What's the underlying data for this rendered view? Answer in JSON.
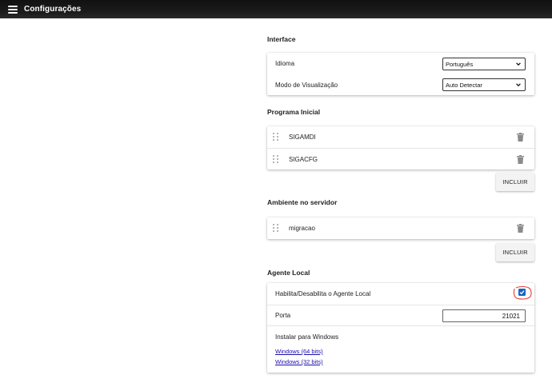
{
  "header": {
    "title": "Configurações",
    "menu_icon": "hamburger-menu-icon"
  },
  "interface": {
    "title": "Interface",
    "idioma_label": "Idioma",
    "idioma_value": "Português",
    "modo_label": "Modo de Visualização",
    "modo_value": "Auto Detectar"
  },
  "programa_inicial": {
    "title": "Programa Inicial",
    "items": [
      {
        "label": "SIGAMDI"
      },
      {
        "label": "SIGACFG"
      }
    ],
    "include_label": "INCLUIR"
  },
  "ambiente": {
    "title": "Ambiente no servidor",
    "items": [
      {
        "label": "migracao"
      }
    ],
    "include_label": "INCLUIR"
  },
  "agente_local": {
    "title": "Agente Local",
    "toggle_label": "Habilita/Desabilita o Agente Local",
    "toggle_checked": true,
    "porta_label": "Porta",
    "porta_value": "21021",
    "install_label": "Instalar para Windows",
    "links": [
      {
        "label": "Windows (64 bits)"
      },
      {
        "label": "Windows (32 bits)"
      }
    ]
  },
  "colors": {
    "topbar": "#1a1a1a",
    "checkbox": "#1565c0",
    "annotation": "#e53935",
    "link": "#1a0dab"
  }
}
